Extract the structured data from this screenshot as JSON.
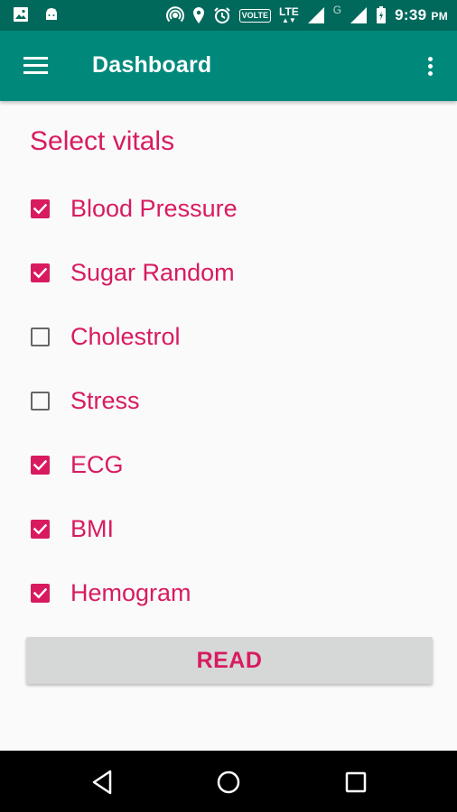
{
  "status_bar": {
    "time": "9:39",
    "ampm": "PM",
    "volte_label": "VOLTE",
    "lte_label": "LTE",
    "g_label": "G",
    "icons": [
      "image-icon",
      "android-icon",
      "hotspot-icon",
      "location-icon",
      "alarm-icon",
      "signal-icon",
      "battery-icon"
    ]
  },
  "app_bar": {
    "title": "Dashboard",
    "menu_icon": "hamburger-menu-icon",
    "overflow_icon": "more-vert-icon",
    "color": "#00897b"
  },
  "section_title": "Select vitals",
  "vitals": [
    {
      "label": "Blood Pressure",
      "checked": true
    },
    {
      "label": "Sugar Random",
      "checked": true
    },
    {
      "label": "Cholestrol",
      "checked": false
    },
    {
      "label": "Stress",
      "checked": false
    },
    {
      "label": "ECG",
      "checked": true
    },
    {
      "label": "BMI",
      "checked": true
    },
    {
      "label": "Hemogram",
      "checked": true
    }
  ],
  "read_button": {
    "label": "READ"
  },
  "nav_bar": {
    "buttons": [
      "back-icon",
      "home-icon",
      "recents-icon"
    ]
  },
  "colors": {
    "accent": "#d81b60",
    "primary": "#00897b",
    "primary_dark": "#00695c"
  }
}
